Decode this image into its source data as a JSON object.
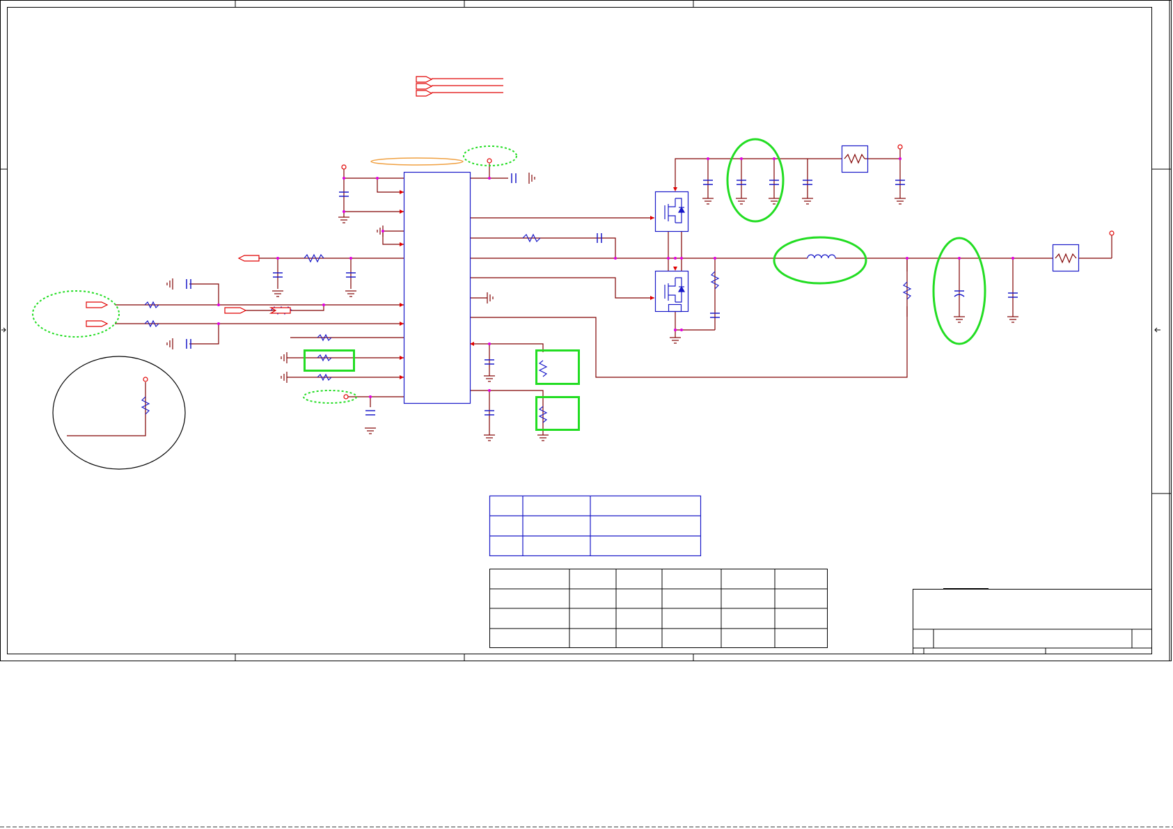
{
  "document": {
    "type": "schematic",
    "text_labels": []
  },
  "colors": {
    "background": "#ffffff",
    "frame": "#000000",
    "wire": "#800000",
    "part": "#1818c8",
    "port": "#e00000",
    "junction": "#e000e0",
    "highlight_green": "#22dd22",
    "highlight_orange": "#f0a040"
  },
  "icons": {
    "ground": "ground-symbol-icon",
    "resistor": "resistor-icon",
    "capacitor": "capacitor-icon",
    "inductor": "inductor-icon",
    "mosfet": "mosfet-icon",
    "power": "power-rail-icon",
    "port": "net-port-icon",
    "fuse": "fuse-icon"
  }
}
